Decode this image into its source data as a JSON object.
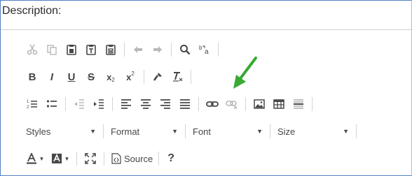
{
  "editor": {
    "label": "Description:"
  },
  "toolbar": {
    "row1": [
      "cut-icon",
      "copy-icon",
      "paste-icon",
      "paste-text-icon",
      "paste-word-icon",
      "undo-icon",
      "redo-icon",
      "find-icon",
      "replace-icon"
    ],
    "row2": {
      "bold": "B",
      "italic": "I",
      "underline": "U",
      "strike": "S",
      "subscript": "x",
      "superscript": "x"
    },
    "combos": {
      "styles": "Styles",
      "format": "Format",
      "font": "Font",
      "size": "Size"
    },
    "source_label": "Source",
    "help_label": "?"
  },
  "colors": {
    "border": "#4f81c7",
    "icon": "#474747",
    "disabled_icon": "#b8b8b8",
    "annotation_arrow": "#3aa935"
  }
}
